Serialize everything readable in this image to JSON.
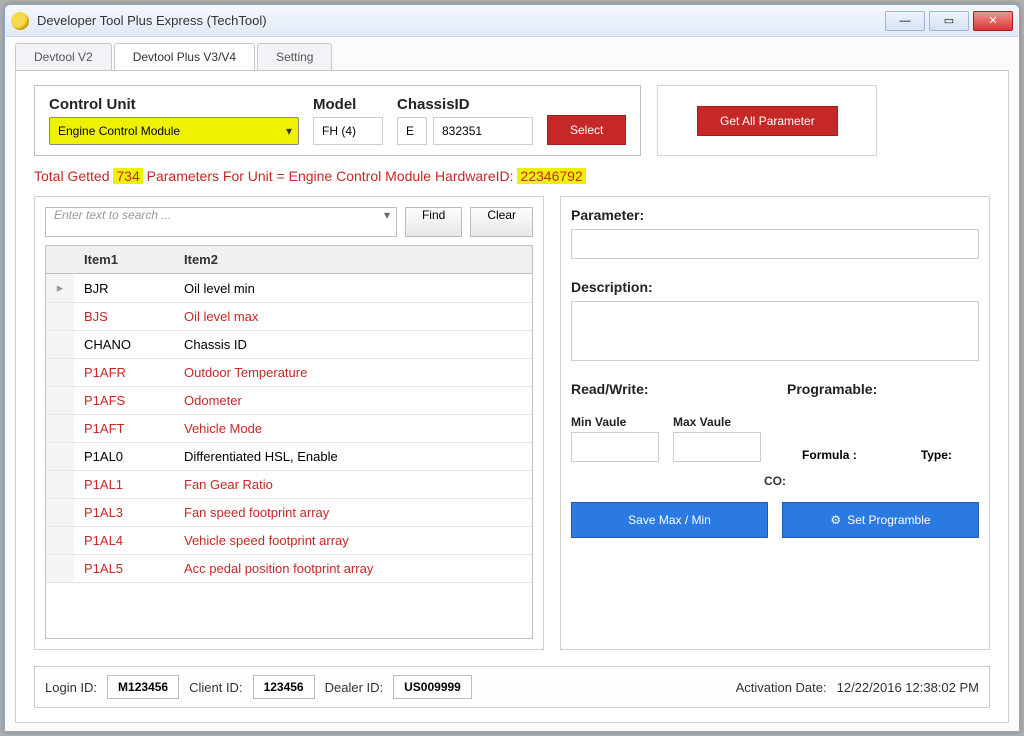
{
  "window": {
    "title": "Developer Tool Plus  Express (TechTool)"
  },
  "tabs": [
    "Devtool V2",
    "Devtool Plus V3/V4",
    "Setting"
  ],
  "active_tab": 1,
  "selector": {
    "control_unit_label": "Control Unit",
    "control_unit_value": "Engine Control Module",
    "model_label": "Model",
    "model_value": "FH (4)",
    "chassis_label": "ChassisID",
    "chassis_prefix": "E",
    "chassis_value": "832351",
    "select_btn": "Select",
    "get_all_btn": "Get All Parameter"
  },
  "status": {
    "prefix": "Total Getted ",
    "count": "734",
    "mid": " Parameters For  Unit = Engine Control Module HardwareID: ",
    "hwid": "22346792"
  },
  "search": {
    "placeholder": "Enter text to search ...",
    "find_btn": "Find",
    "clear_btn": "Clear"
  },
  "grid": {
    "cols": [
      "",
      "Item1",
      "Item2"
    ],
    "rows": [
      {
        "m": "▸",
        "a": "BJR",
        "b": "Oil level min",
        "red": false
      },
      {
        "m": "",
        "a": "BJS",
        "b": "Oil level max",
        "red": true
      },
      {
        "m": "",
        "a": "CHANO",
        "b": "Chassis ID",
        "red": false
      },
      {
        "m": "",
        "a": "P1AFR",
        "b": "Outdoor Temperature",
        "red": true
      },
      {
        "m": "",
        "a": "P1AFS",
        "b": "Odometer",
        "red": true
      },
      {
        "m": "",
        "a": "P1AFT",
        "b": "Vehicle Mode",
        "red": true
      },
      {
        "m": "",
        "a": "P1AL0",
        "b": "Differentiated HSL, Enable",
        "red": false
      },
      {
        "m": "",
        "a": "P1AL1",
        "b": "Fan Gear Ratio",
        "red": true
      },
      {
        "m": "",
        "a": "P1AL3",
        "b": "Fan speed footprint array",
        "red": true
      },
      {
        "m": "",
        "a": "P1AL4",
        "b": "Vehicle speed footprint array",
        "red": true
      },
      {
        "m": "",
        "a": "P1AL5",
        "b": "Acc pedal position footprint array",
        "red": true
      }
    ]
  },
  "detail": {
    "param_label": "Parameter:",
    "desc_label": "Description:",
    "rw_label": "Read/Write:",
    "prog_label": "Programable:",
    "min_label": "Min Vaule",
    "max_label": "Max Vaule",
    "formula_label": "Formula :",
    "type_label": "Type:",
    "co_label": "CO:",
    "save_btn": "Save Max / Min",
    "setprog_btn": "Set Programble"
  },
  "footer": {
    "login_label": "Login ID:",
    "login_val": "M123456",
    "client_label": "Client ID:",
    "client_val": "123456",
    "dealer_label": "Dealer ID:",
    "dealer_val": "US009999",
    "activate_label": "Activation Date:",
    "activate_val": "12/22/2016 12:38:02 PM"
  }
}
